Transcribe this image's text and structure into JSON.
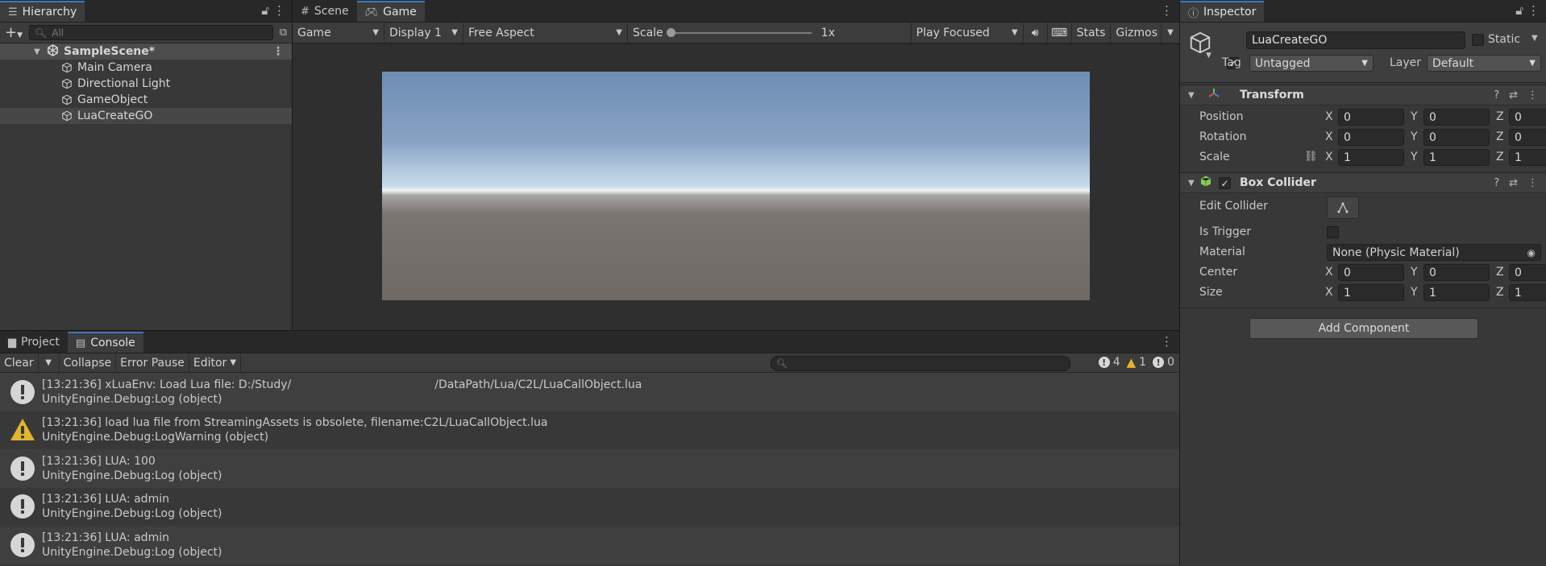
{
  "hierarchy": {
    "tab_label": "Hierarchy",
    "search_placeholder": "All",
    "scene_name": "SampleScene*",
    "items": [
      {
        "label": "Main Camera"
      },
      {
        "label": "Directional Light"
      },
      {
        "label": "GameObject"
      },
      {
        "label": "LuaCreateGO"
      }
    ]
  },
  "gameview": {
    "tabs": [
      {
        "label": "Scene"
      },
      {
        "label": "Game"
      }
    ],
    "toolbar": {
      "view_mode": "Game",
      "display": "Display 1",
      "aspect": "Free Aspect",
      "scale_label": "Scale",
      "scale_value": "1x",
      "play_mode": "Play Focused",
      "stats": "Stats",
      "gizmos": "Gizmos"
    }
  },
  "inspector": {
    "tab_label": "Inspector",
    "object_name": "LuaCreateGO",
    "static_label": "Static",
    "tag_label": "Tag",
    "tag_value": "Untagged",
    "layer_label": "Layer",
    "layer_value": "Default",
    "transform": {
      "title": "Transform",
      "rows": [
        {
          "label": "Position",
          "x": "0",
          "y": "0",
          "z": "0"
        },
        {
          "label": "Rotation",
          "x": "0",
          "y": "0",
          "z": "0"
        },
        {
          "label": "Scale",
          "x": "1",
          "y": "1",
          "z": "1"
        }
      ]
    },
    "box_collider": {
      "title": "Box Collider",
      "edit_collider_label": "Edit Collider",
      "is_trigger_label": "Is Trigger",
      "material_label": "Material",
      "material_value": "None (Physic Material)",
      "center": {
        "label": "Center",
        "x": "0",
        "y": "0",
        "z": "0"
      },
      "size": {
        "label": "Size",
        "x": "1",
        "y": "1",
        "z": "1"
      }
    },
    "add_component_label": "Add Component",
    "axes": {
      "x": "X",
      "y": "Y",
      "z": "Z"
    }
  },
  "console": {
    "tabs": [
      {
        "label": "Project"
      },
      {
        "label": "Console"
      }
    ],
    "toolbar": {
      "clear": "Clear",
      "collapse": "Collapse",
      "error_pause": "Error Pause",
      "editor": "Editor"
    },
    "counts": {
      "info": "4",
      "warning": "1",
      "error": "0"
    },
    "logs": [
      {
        "type": "info",
        "line1": "[13:21:36] xLuaEnv: Load Lua file: D:/Study/                                        /DataPath/Lua/C2L/LuaCallObject.lua",
        "line2": "UnityEngine.Debug:Log (object)"
      },
      {
        "type": "warning",
        "line1": "[13:21:36] load lua file from StreamingAssets is obsolete, filename:C2L/LuaCallObject.lua",
        "line2": "UnityEngine.Debug:LogWarning (object)"
      },
      {
        "type": "info",
        "line1": "[13:21:36] LUA: 100",
        "line2": "UnityEngine.Debug:Log (object)"
      },
      {
        "type": "info",
        "line1": "[13:21:36] LUA: admin",
        "line2": "UnityEngine.Debug:Log (object)"
      },
      {
        "type": "info",
        "line1": "[13:21:36] LUA: admin",
        "line2": "UnityEngine.Debug:Log (object)"
      }
    ]
  }
}
